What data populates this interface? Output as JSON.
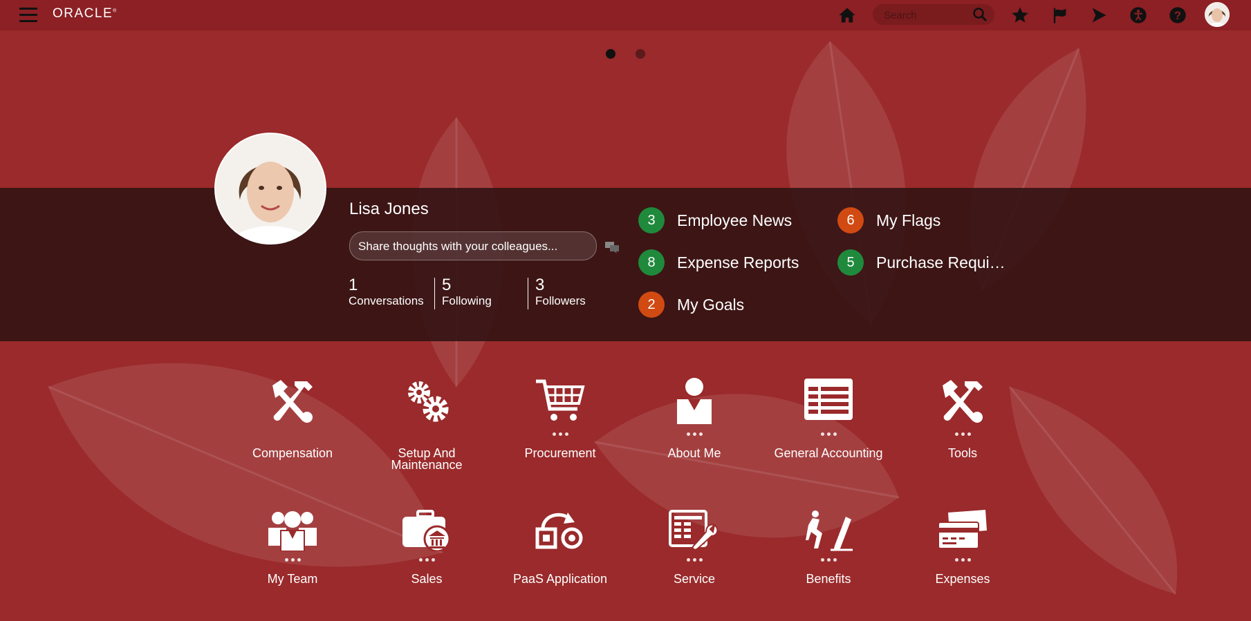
{
  "header": {
    "logo": "ORACLE",
    "search_placeholder": "Search",
    "icons": [
      "menu-icon",
      "home-icon",
      "search-icon",
      "star-icon",
      "flag-icon",
      "play-icon",
      "accessibility-icon",
      "help-icon"
    ]
  },
  "carousel": {
    "pages": 2,
    "active": 1
  },
  "profile": {
    "name": "Lisa Jones",
    "share_placeholder": "Share thoughts with your colleagues...",
    "stats": [
      {
        "num": "1",
        "label": "Conversations"
      },
      {
        "num": "5",
        "label": "Following"
      },
      {
        "num": "3",
        "label": "Followers"
      }
    ]
  },
  "notifications": [
    {
      "count": "3",
      "label": "Employee News",
      "color": "#1f8a3c"
    },
    {
      "count": "8",
      "label": "Expense Reports",
      "color": "#1f8a3c"
    },
    {
      "count": "2",
      "label": "My Goals",
      "color": "#d14a12"
    },
    {
      "count": "6",
      "label": "My Flags",
      "color": "#d14a12"
    },
    {
      "count": "5",
      "label": "Purchase Requi…",
      "color": "#1f8a3c"
    }
  ],
  "apps_row1": [
    {
      "label": "Compensation",
      "icon": "tools-icon"
    },
    {
      "label": "Setup And Maintenance",
      "icon": "gears-icon"
    },
    {
      "label": "Procurement",
      "icon": "cart-icon"
    },
    {
      "label": "About Me",
      "icon": "person-icon"
    },
    {
      "label": "General Accounting",
      "icon": "ledger-icon"
    },
    {
      "label": "Tools",
      "icon": "tools-icon"
    }
  ],
  "apps_row2": [
    {
      "label": "My Team",
      "icon": "team-icon"
    },
    {
      "label": "Sales",
      "icon": "briefcase-icon"
    },
    {
      "label": "PaaS Application",
      "icon": "paas-icon"
    },
    {
      "label": "Service",
      "icon": "service-icon"
    },
    {
      "label": "Benefits",
      "icon": "benefits-icon"
    },
    {
      "label": "Expenses",
      "icon": "credit-card-icon"
    }
  ],
  "colors": {
    "background": "#9a2a2b",
    "topbar": "#8c2024",
    "band": "#301212"
  }
}
